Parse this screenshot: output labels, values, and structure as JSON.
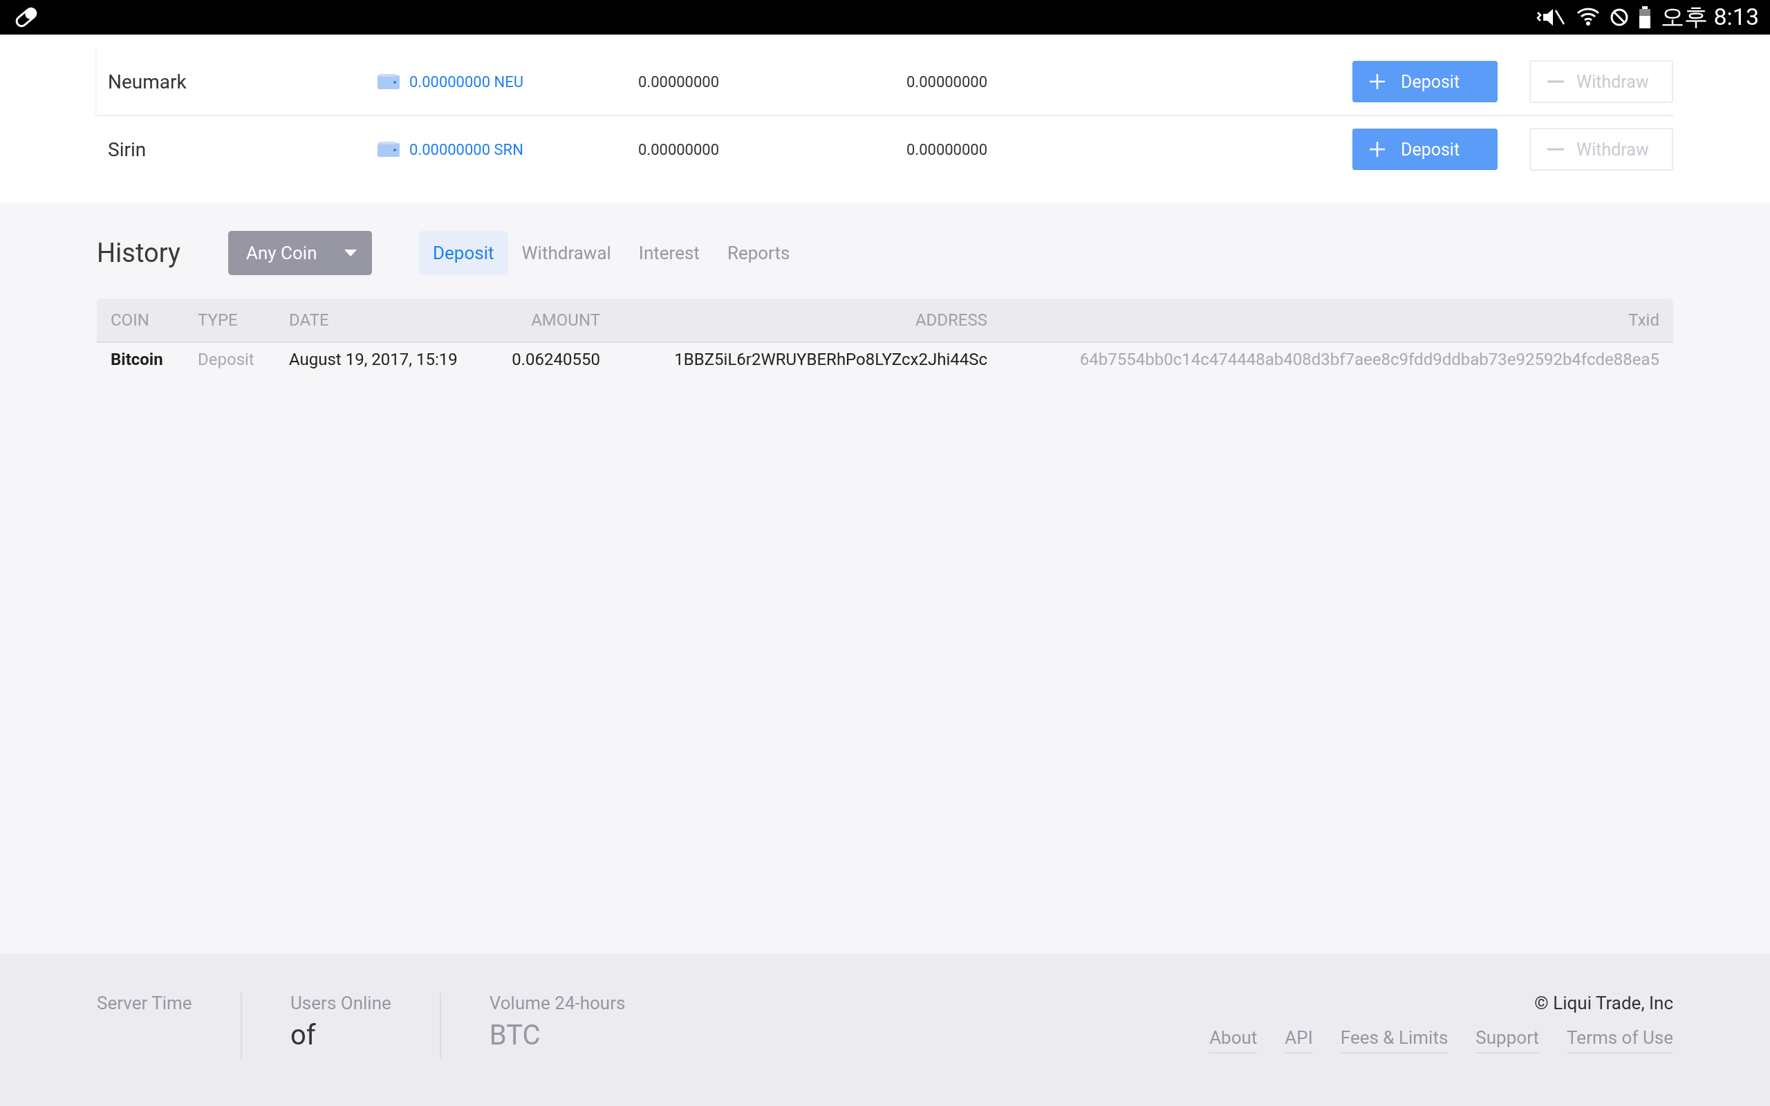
{
  "status_bar": {
    "time": "오후 8:13"
  },
  "wallets": [
    {
      "name": "Neumark",
      "balance": "0.00000000 NEU",
      "column_3": "0.00000000",
      "column_4": "0.00000000",
      "deposit": "Deposit",
      "withdraw": "Withdraw",
      "withdraw_disabled": true
    },
    {
      "name": "Sirin",
      "balance": "0.00000000 SRN",
      "column_3": "0.00000000",
      "column_4": "0.00000000",
      "deposit": "Deposit",
      "withdraw": "Withdraw",
      "withdraw_disabled": true
    }
  ],
  "history": {
    "title": "History",
    "coin_filter": "Any Coin",
    "tabs": [
      {
        "label": "Deposit",
        "selected": true
      },
      {
        "label": "Withdrawal",
        "selected": false
      },
      {
        "label": "Interest",
        "selected": false
      },
      {
        "label": "Reports",
        "selected": false
      }
    ],
    "table": {
      "columns": [
        "COIN",
        "TYPE",
        "DATE",
        "AMOUNT",
        "ADDRESS",
        "Txid"
      ],
      "rows": [
        {
          "coin": "Bitcoin",
          "type": "Deposit",
          "date": "August 19, 2017, 15:19",
          "amount": "0.06240550",
          "address": "1BBZ5iL6r2WRUYBERhPo8LYZcx2Jhi44Sc",
          "txid": "64b7554bb0c14c474448ab408d3bf7aee8c9fdd9ddbab73e92592b4fcde88ea5"
        }
      ]
    }
  },
  "footer": {
    "stats": [
      {
        "label": "Server Time"
      },
      {
        "label": "Users Online",
        "value": "of"
      },
      {
        "label": "Volume 24-hours",
        "value": "BTC"
      }
    ],
    "copyright": "© Liqui Trade, Inc",
    "links": [
      "About",
      "API",
      "Fees & Limits",
      "Support",
      "Terms of Use"
    ]
  }
}
